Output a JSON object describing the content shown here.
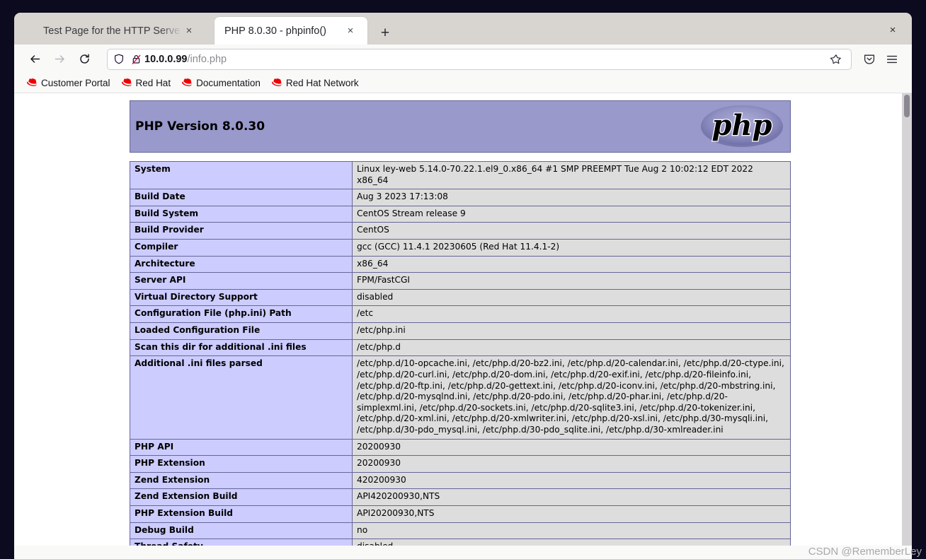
{
  "browser": {
    "tabs": [
      {
        "title": "Test Page for the HTTP Serve",
        "close_label": "×",
        "active": false
      },
      {
        "title": "PHP 8.0.30 - phpinfo()",
        "close_label": "×",
        "active": true
      }
    ],
    "new_tab_label": "+",
    "window_close_label": "×",
    "nav": {
      "back_icon": "back-arrow-icon",
      "forward_icon": "forward-arrow-icon",
      "reload_icon": "reload-icon"
    },
    "address_bar": {
      "host": "10.0.0.99",
      "path": "/info.php",
      "full_url": "10.0.0.99/info.php",
      "shield_icon": "shield-icon",
      "lock_icon": "lock-crossed-out-icon",
      "star_icon": "bookmark-star-icon"
    },
    "toolbar_icons": [
      {
        "name": "pocket-save-icon"
      },
      {
        "name": "hamburger-menu-icon"
      }
    ],
    "bookmarks": [
      {
        "label": "Customer Portal",
        "icon": "redhat-icon"
      },
      {
        "label": "Red Hat",
        "icon": "redhat-icon"
      },
      {
        "label": "Documentation",
        "icon": "redhat-icon"
      },
      {
        "label": "Red Hat Network",
        "icon": "redhat-icon"
      }
    ]
  },
  "colors": {
    "banner_bg": "#9999cc",
    "banner_border": "#666699",
    "key_cell_bg": "#ccccff",
    "value_cell_bg": "#dddddd",
    "desktop_bg": "#0b0a1e"
  },
  "phpinfo": {
    "heading": "PHP Version 8.0.30",
    "logo_text": "php",
    "rows": [
      {
        "key": "System",
        "value": "Linux ley-web 5.14.0-70.22.1.el9_0.x86_64 #1 SMP PREEMPT Tue Aug 2 10:02:12 EDT 2022 x86_64"
      },
      {
        "key": "Build Date",
        "value": "Aug 3 2023 17:13:08"
      },
      {
        "key": "Build System",
        "value": "CentOS Stream release 9"
      },
      {
        "key": "Build Provider",
        "value": "CentOS"
      },
      {
        "key": "Compiler",
        "value": "gcc (GCC) 11.4.1 20230605 (Red Hat 11.4.1-2)"
      },
      {
        "key": "Architecture",
        "value": "x86_64"
      },
      {
        "key": "Server API",
        "value": "FPM/FastCGI"
      },
      {
        "key": "Virtual Directory Support",
        "value": "disabled"
      },
      {
        "key": "Configuration File (php.ini) Path",
        "value": "/etc"
      },
      {
        "key": "Loaded Configuration File",
        "value": "/etc/php.ini"
      },
      {
        "key": "Scan this dir for additional .ini files",
        "value": "/etc/php.d"
      },
      {
        "key": "Additional .ini files parsed",
        "value": "/etc/php.d/10-opcache.ini, /etc/php.d/20-bz2.ini, /etc/php.d/20-calendar.ini, /etc/php.d/20-ctype.ini, /etc/php.d/20-curl.ini, /etc/php.d/20-dom.ini, /etc/php.d/20-exif.ini, /etc/php.d/20-fileinfo.ini, /etc/php.d/20-ftp.ini, /etc/php.d/20-gettext.ini, /etc/php.d/20-iconv.ini, /etc/php.d/20-mbstring.ini, /etc/php.d/20-mysqlnd.ini, /etc/php.d/20-pdo.ini, /etc/php.d/20-phar.ini, /etc/php.d/20-simplexml.ini, /etc/php.d/20-sockets.ini, /etc/php.d/20-sqlite3.ini, /etc/php.d/20-tokenizer.ini, /etc/php.d/20-xml.ini, /etc/php.d/20-xmlwriter.ini, /etc/php.d/20-xsl.ini, /etc/php.d/30-mysqli.ini, /etc/php.d/30-pdo_mysql.ini, /etc/php.d/30-pdo_sqlite.ini, /etc/php.d/30-xmlreader.ini"
      },
      {
        "key": "PHP API",
        "value": "20200930"
      },
      {
        "key": "PHP Extension",
        "value": "20200930"
      },
      {
        "key": "Zend Extension",
        "value": "420200930"
      },
      {
        "key": "Zend Extension Build",
        "value": "API420200930,NTS"
      },
      {
        "key": "PHP Extension Build",
        "value": "API20200930,NTS"
      },
      {
        "key": "Debug Build",
        "value": "no"
      },
      {
        "key": "Thread Safety",
        "value": "disabled"
      }
    ]
  },
  "watermark": "CSDN @RememberLey"
}
